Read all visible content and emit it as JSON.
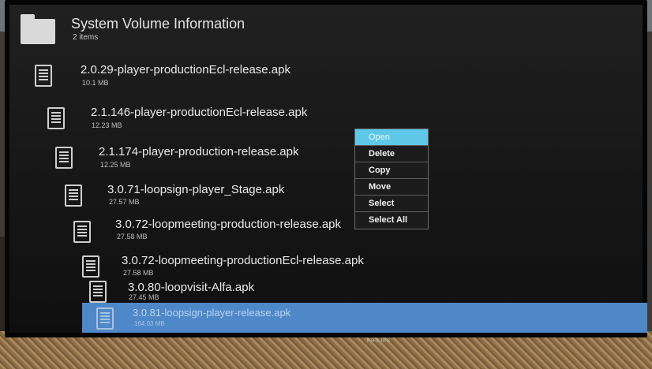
{
  "folder": {
    "title": "System Volume Information",
    "count": "2 items"
  },
  "files": [
    {
      "name": "2.0.29-player-productionEcl-release.apk",
      "size": "10.1 MB"
    },
    {
      "name": "2.1.146-player-productionEcl-release.apk",
      "size": "12.23 MB"
    },
    {
      "name": "2.1.174-player-production-release.apk",
      "size": "12.25 MB"
    },
    {
      "name": "3.0.71-loopsign-player_Stage.apk",
      "size": "27.57 MB"
    },
    {
      "name": "3.0.72-loopmeeting-production-release.apk",
      "size": "27.58 MB"
    },
    {
      "name": "3.0.72-loopmeeting-productionEcl-release.apk",
      "size": "27.58 MB"
    },
    {
      "name": "3.0.80-loopvisit-Alfa.apk",
      "size": "27.45 MB"
    },
    {
      "name": "3.0.81-loopsign-player-release.apk",
      "size": "164.03 MB",
      "selected": true
    }
  ],
  "context_menu": {
    "items": [
      "Open",
      "Delete",
      "Copy",
      "Move",
      "Select",
      "Select All"
    ],
    "highlighted": "Open"
  },
  "monitor": {
    "brand": "PHILIPS"
  },
  "colors": {
    "selection": "#4f88c8",
    "menu_highlight": "#5fc7e8",
    "screen_bg": "#151515"
  }
}
